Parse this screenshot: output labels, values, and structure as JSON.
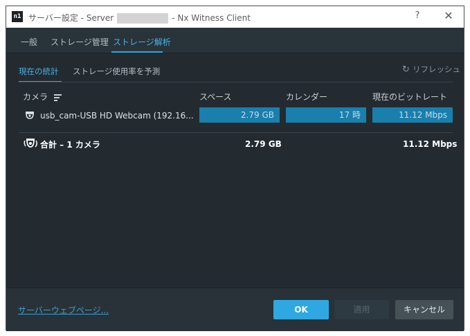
{
  "window": {
    "title_prefix": "サーバー設定 - Server",
    "title_suffix": "- Nx Witness Client",
    "app_icon_text": "n1",
    "help_symbol": "?",
    "close_symbol": "✕"
  },
  "tabs": [
    {
      "label": "一般",
      "active": false
    },
    {
      "label": "ストレージ管理",
      "active": false
    },
    {
      "label": "ストレージ解析",
      "active": true
    }
  ],
  "subtabs": [
    {
      "label": "現在の統計",
      "active": true
    },
    {
      "label": "ストレージ使用率を予測",
      "active": false
    }
  ],
  "refresh_label": "リフレッシュ",
  "table": {
    "columns": [
      "カメラ",
      "スペース",
      "カレンダー",
      "現在のビットレート"
    ],
    "rows": [
      {
        "camera": "usb_cam-USB HD Webcam (192.16...",
        "space": "2.79 GB",
        "calendar": "17 時",
        "bitrate": "11.12 Mbps"
      }
    ],
    "total": {
      "label": "合計 – 1 カメラ",
      "space": "2.79 GB",
      "bitrate": "11.12 Mbps"
    }
  },
  "footer": {
    "web_page_link": "サーバーウェブページ...",
    "ok_label": "OK",
    "apply_label": "適用",
    "cancel_label": "キャンセル"
  },
  "colors": {
    "accent": "#2fa8e2",
    "background": "#232b31",
    "bar": "#197fad"
  }
}
